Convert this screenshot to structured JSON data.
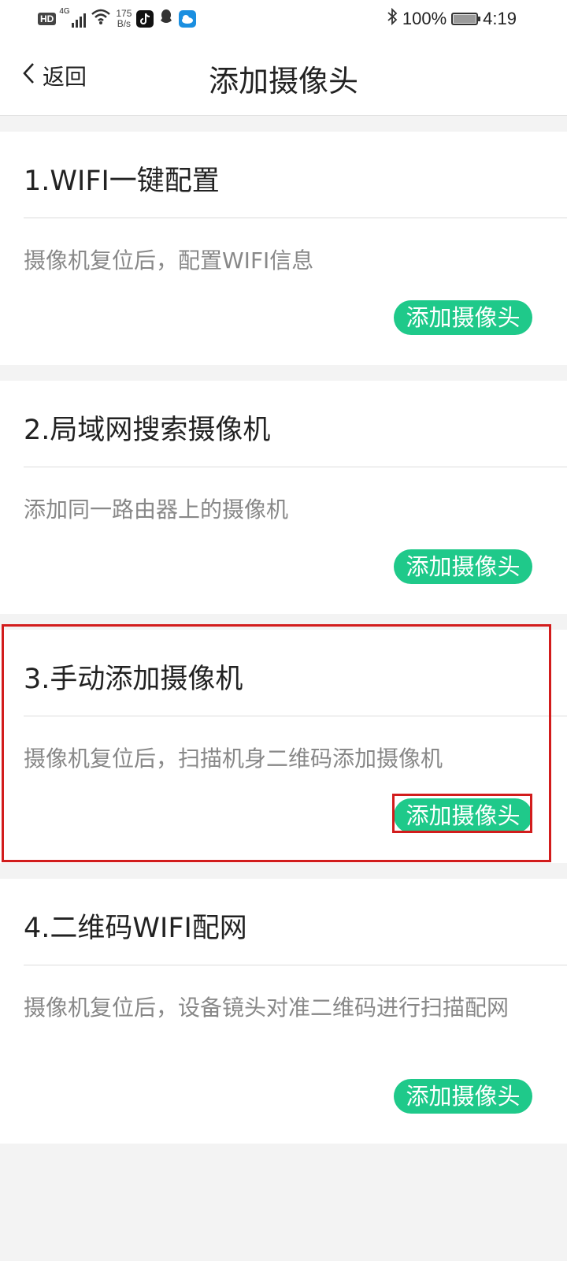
{
  "status_bar": {
    "hd": "HD",
    "signal": "4G",
    "speed_value": "175",
    "speed_unit": "B/s",
    "battery_percent": "100%",
    "battery_level": 1.0,
    "time": "4:19",
    "icons": [
      "signal-icon",
      "wifi-icon",
      "tiktok-icon",
      "qq-icon",
      "weather-icon",
      "bluetooth-icon",
      "battery-icon"
    ]
  },
  "nav": {
    "back_label": "返回",
    "title": "添加摄像头"
  },
  "cards": [
    {
      "title": "1.WIFI一键配置",
      "description": "摄像机复位后，配置WIFI信息",
      "button": "添加摄像头"
    },
    {
      "title": "2.局域网搜索摄像机",
      "description": "添加同一路由器上的摄像机",
      "button": "添加摄像头"
    },
    {
      "title": "3.手动添加摄像机",
      "description": "摄像机复位后，扫描机身二维码添加摄像机",
      "button": "添加摄像头"
    },
    {
      "title": "4.二维码WIFI配网",
      "description": "摄像机复位后，设备镜头对准二维码进行扫描配网",
      "button": "添加摄像头"
    }
  ],
  "colors": {
    "accent": "#1fc98a",
    "highlight": "#d21c1c",
    "background": "#f3f3f3"
  }
}
